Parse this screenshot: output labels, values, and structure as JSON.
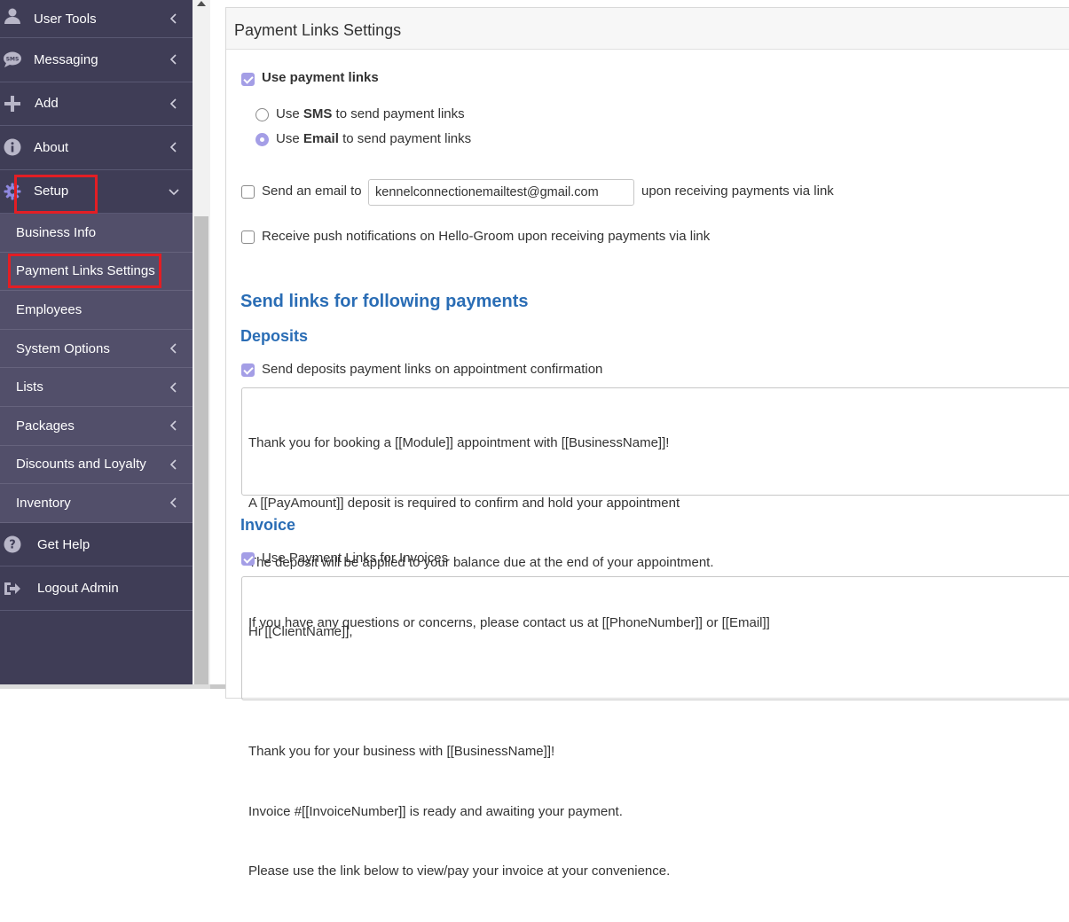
{
  "sidebar": {
    "items": [
      {
        "label": "User Tools",
        "icon": "user-icon"
      },
      {
        "label": "Messaging",
        "icon": "sms-icon"
      },
      {
        "label": "Add",
        "icon": "plus-icon"
      },
      {
        "label": "About",
        "icon": "info-icon"
      },
      {
        "label": "Setup",
        "icon": "gear-icon"
      }
    ],
    "setup_sub": [
      {
        "label": "Business Info"
      },
      {
        "label": "Payment Links Settings"
      },
      {
        "label": "Employees"
      },
      {
        "label": "System Options"
      },
      {
        "label": "Lists"
      },
      {
        "label": "Packages"
      },
      {
        "label": "Discounts and Loyalty"
      },
      {
        "label": "Inventory"
      }
    ],
    "bottom": [
      {
        "label": "Get Help",
        "icon": "question-icon"
      },
      {
        "label": "Logout Admin",
        "icon": "logout-icon"
      }
    ]
  },
  "panel": {
    "title": "Payment Links Settings",
    "use_payment_links": {
      "label": "Use payment links",
      "checked": true
    },
    "send_via": {
      "use_prefix": "Use",
      "sms_word": "SMS",
      "sms_suffix": "to send payment links",
      "email_word": "Email",
      "email_suffix": "to send payment links",
      "selected": "email"
    },
    "send_email": {
      "label": "Send an email to",
      "value": "kennelconnectionemailtest@gmail.com",
      "suffix": "upon receiving payments via link",
      "checked": false
    },
    "push_notify": {
      "label": "Receive push notifications on Hello-Groom upon receiving payments via link",
      "checked": false
    },
    "section_title": "Send links for following payments",
    "deposits": {
      "title": "Deposits",
      "checkbox_label": "Send deposits payment links on appointment confirmation",
      "checked": true,
      "message_lines": [
        "Thank you for booking a [[Module]] appointment with [[BusinessName]]!",
        "A [[PayAmount]] deposit is required to confirm and hold your appointment",
        "The deposit will be applied to your balance due at the end of your appointment.",
        "If you have any questions or concerns, please contact us at [[PhoneNumber]] or [[Email]]"
      ]
    },
    "invoice": {
      "title": "Invoice",
      "checkbox_label": "Use Payment Links for Invoices",
      "checked": true,
      "message_lines": [
        "Hi [[ClientName]],",
        "",
        "Thank you for your business with [[BusinessName]]!",
        "Invoice #[[InvoiceNumber]] is ready and awaiting your payment.",
        "Please use the link below to view/pay your invoice at your convenience."
      ]
    }
  },
  "colors": {
    "sidebar_bg": "#3f3d56",
    "submenu_bg": "#524f6a",
    "accent": "#a49ee6",
    "heading_blue": "#2a6db5",
    "highlight_red": "#e31e24"
  }
}
